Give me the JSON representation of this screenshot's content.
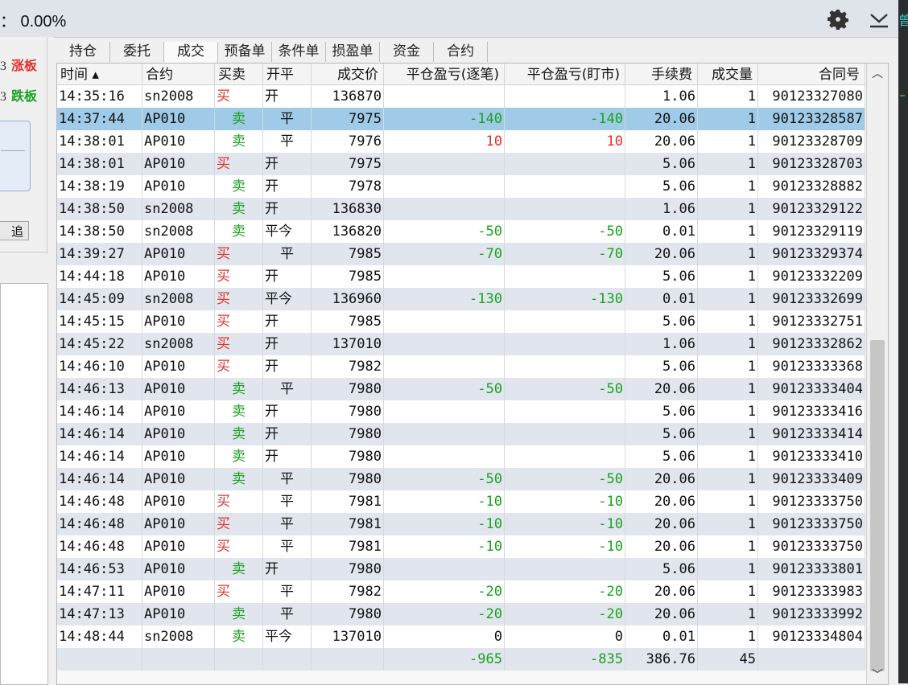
{
  "topbar": {
    "ratio_text": "： 0.00%",
    "icons": [
      "gear-icon",
      "collapse-down-icon"
    ]
  },
  "rightstrip": {
    "text": "曾"
  },
  "leftpanel": {
    "limit_up": {
      "num": "3",
      "label": "涨板"
    },
    "limit_down": {
      "num": "3",
      "label": "跌板"
    },
    "chase_button": "追"
  },
  "tabs": [
    {
      "label": "持仓",
      "active": false
    },
    {
      "label": "委托",
      "active": false
    },
    {
      "label": "成交",
      "active": true
    },
    {
      "label": "预备单",
      "active": false
    },
    {
      "label": "条件单",
      "active": false
    },
    {
      "label": "损盈单",
      "active": false
    },
    {
      "label": "资金",
      "active": false
    },
    {
      "label": "合约",
      "active": false
    }
  ],
  "table": {
    "columns": [
      "时间 ▴",
      "合约",
      "买卖",
      "开平",
      "成交价",
      "平仓盈亏(逐笔)",
      "平仓盈亏(盯市)",
      "手续费",
      "成交量",
      "合同号"
    ],
    "selected_row": 1,
    "rows": [
      [
        "14:35:16",
        "sn2008",
        "买",
        "开",
        "136870",
        "",
        "",
        "1.06",
        "1",
        "90123327080"
      ],
      [
        "14:37:44",
        "AP010",
        "卖",
        "平",
        "7975",
        "-140",
        "-140",
        "20.06",
        "1",
        "90123328587"
      ],
      [
        "14:38:01",
        "AP010",
        "卖",
        "平",
        "7976",
        "10",
        "10",
        "20.06",
        "1",
        "90123328709"
      ],
      [
        "14:38:01",
        "AP010",
        "买",
        "开",
        "7975",
        "",
        "",
        "5.06",
        "1",
        "90123328703"
      ],
      [
        "14:38:19",
        "AP010",
        "卖",
        "开",
        "7978",
        "",
        "",
        "5.06",
        "1",
        "90123328882"
      ],
      [
        "14:38:50",
        "sn2008",
        "卖",
        "开",
        "136830",
        "",
        "",
        "1.06",
        "1",
        "90123329122"
      ],
      [
        "14:38:50",
        "sn2008",
        "卖",
        "平今",
        "136820",
        "-50",
        "-50",
        "0.01",
        "1",
        "90123329119"
      ],
      [
        "14:39:27",
        "AP010",
        "买",
        "平",
        "7985",
        "-70",
        "-70",
        "20.06",
        "1",
        "90123329374"
      ],
      [
        "14:44:18",
        "AP010",
        "买",
        "开",
        "7985",
        "",
        "",
        "5.06",
        "1",
        "90123332209"
      ],
      [
        "14:45:09",
        "sn2008",
        "买",
        "平今",
        "136960",
        "-130",
        "-130",
        "0.01",
        "1",
        "90123332699"
      ],
      [
        "14:45:15",
        "AP010",
        "买",
        "开",
        "7985",
        "",
        "",
        "5.06",
        "1",
        "90123332751"
      ],
      [
        "14:45:22",
        "sn2008",
        "买",
        "开",
        "137010",
        "",
        "",
        "1.06",
        "1",
        "90123332862"
      ],
      [
        "14:46:10",
        "AP010",
        "买",
        "开",
        "7982",
        "",
        "",
        "5.06",
        "1",
        "90123333368"
      ],
      [
        "14:46:13",
        "AP010",
        "卖",
        "平",
        "7980",
        "-50",
        "-50",
        "20.06",
        "1",
        "90123333404"
      ],
      [
        "14:46:14",
        "AP010",
        "卖",
        "开",
        "7980",
        "",
        "",
        "5.06",
        "1",
        "90123333416"
      ],
      [
        "14:46:14",
        "AP010",
        "卖",
        "开",
        "7980",
        "",
        "",
        "5.06",
        "1",
        "90123333414"
      ],
      [
        "14:46:14",
        "AP010",
        "卖",
        "开",
        "7980",
        "",
        "",
        "5.06",
        "1",
        "90123333410"
      ],
      [
        "14:46:14",
        "AP010",
        "卖",
        "平",
        "7980",
        "-50",
        "-50",
        "20.06",
        "1",
        "90123333409"
      ],
      [
        "14:46:48",
        "AP010",
        "买",
        "平",
        "7981",
        "-10",
        "-10",
        "20.06",
        "1",
        "90123333750"
      ],
      [
        "14:46:48",
        "AP010",
        "买",
        "平",
        "7981",
        "-10",
        "-10",
        "20.06",
        "1",
        "90123333750"
      ],
      [
        "14:46:48",
        "AP010",
        "买",
        "平",
        "7981",
        "-10",
        "-10",
        "20.06",
        "1",
        "90123333750"
      ],
      [
        "14:46:53",
        "AP010",
        "卖",
        "开",
        "7980",
        "",
        "",
        "5.06",
        "1",
        "90123333801"
      ],
      [
        "14:47:11",
        "AP010",
        "买",
        "平",
        "7982",
        "-20",
        "-20",
        "20.06",
        "1",
        "90123333983"
      ],
      [
        "14:47:13",
        "AP010",
        "卖",
        "平",
        "7980",
        "-20",
        "-20",
        "20.06",
        "1",
        "90123333992"
      ],
      [
        "14:48:44",
        "sn2008",
        "卖",
        "平今",
        "137010",
        "0",
        "0",
        "0.01",
        "1",
        "90123334804"
      ]
    ],
    "totals": [
      "",
      "",
      "",
      "",
      "",
      "-965",
      "-835",
      "386.76",
      "45",
      ""
    ]
  },
  "colors": {
    "buy": "#e4312b",
    "sell": "#1aa11f",
    "selected": "#9fcbe8",
    "stripe": "#e1e6ee"
  }
}
